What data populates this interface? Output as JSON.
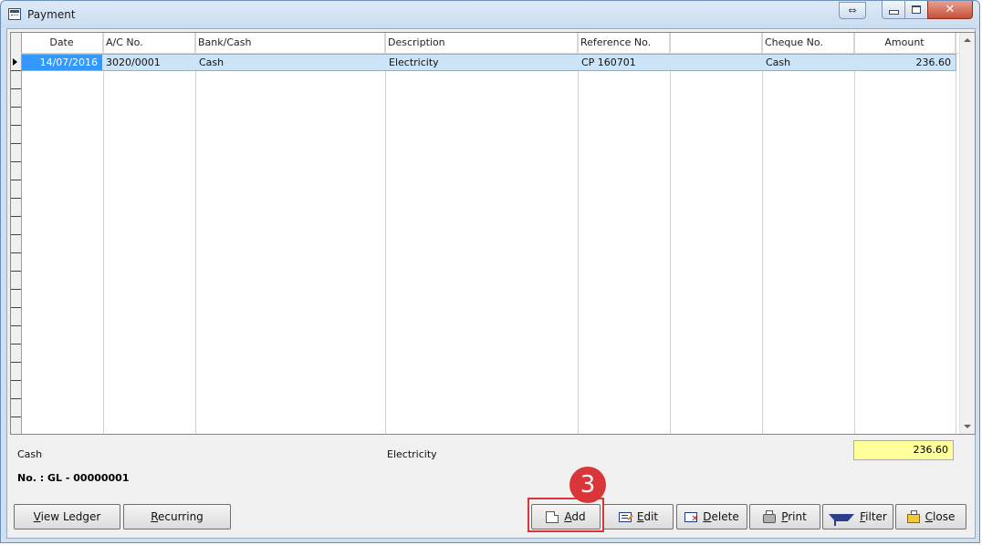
{
  "window": {
    "title": "Payment",
    "close_glyph": "✕",
    "restore_glyph": "⇔"
  },
  "grid": {
    "columns": [
      "Date",
      "A/C No.",
      "Bank/Cash",
      "Description",
      "Reference No.",
      "",
      "Cheque No.",
      "Amount"
    ],
    "rows": [
      {
        "date": "14/07/2016",
        "ac_no": "3020/0001",
        "bank_cash": "Cash",
        "description": "Electricity",
        "reference_no": "CP 160701",
        "blank": "",
        "cheque_no": "Cash",
        "amount": "236.60"
      }
    ]
  },
  "footer": {
    "bank_cash": "Cash",
    "description": "Electricity",
    "total": "236.60",
    "doc_no": "No. : GL - 00000001"
  },
  "buttons": {
    "view_ledger": "View Ledger",
    "recurring": "Recurring",
    "add": "Add",
    "edit": "Edit",
    "delete": "Delete",
    "print": "Print",
    "filter": "Filter",
    "close": "Close"
  },
  "annotation": {
    "step": "3",
    "color": "#d9363a"
  },
  "icons": {
    "add": "new-document-icon",
    "edit": "edit-record-icon",
    "delete": "delete-record-icon",
    "print": "printer-icon",
    "filter": "filter-funnel-icon",
    "close": "folder-close-icon"
  }
}
